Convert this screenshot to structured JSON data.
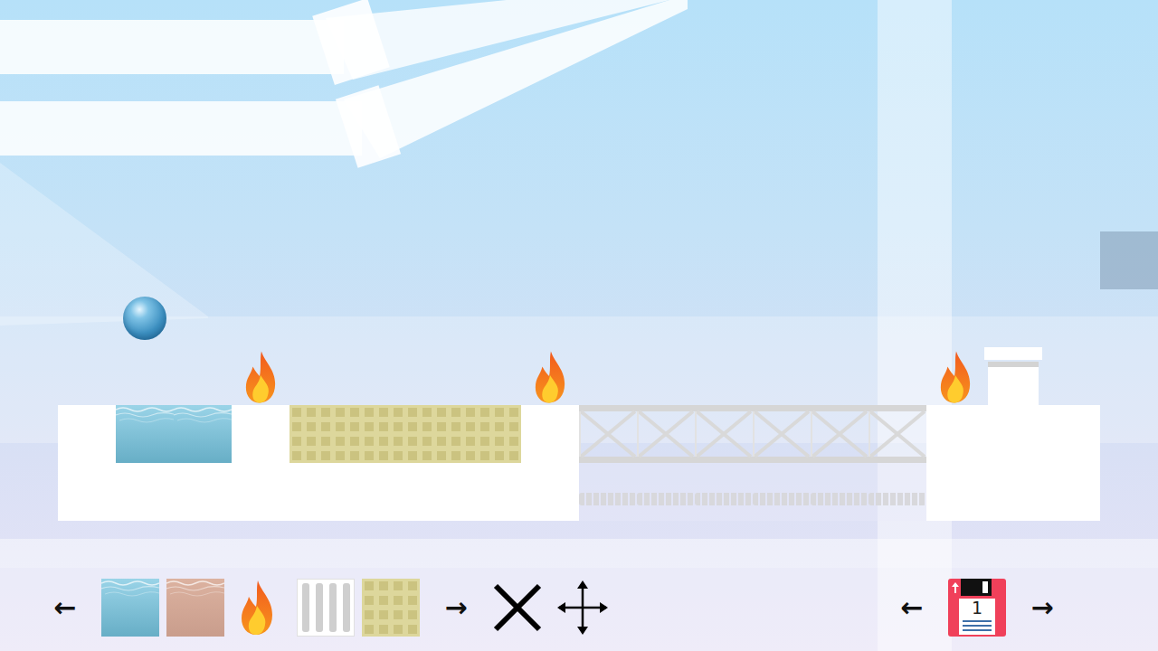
{
  "level": {
    "player": {
      "kind": "drop"
    },
    "grid": [
      [
        "empty",
        "empty",
        "empty",
        "fire",
        "empty",
        "empty",
        "empty",
        "empty",
        "fire",
        "empty",
        "empty",
        "empty",
        "empty",
        "empty",
        "empty",
        "fire",
        "goal",
        "empty"
      ],
      [
        "solid",
        "water",
        "water",
        "solid",
        "grate",
        "grate",
        "grate",
        "grate",
        "solid",
        "bridge",
        "bridge",
        "bridge",
        "bridge",
        "bridge",
        "bridge",
        "solid",
        "solid",
        "solid"
      ],
      [
        "solid",
        "solid",
        "solid",
        "solid",
        "solid",
        "solid",
        "solid",
        "solid",
        "solid",
        "rail",
        "rail",
        "rail",
        "rail",
        "rail",
        "rail",
        "solid",
        "solid",
        "solid"
      ]
    ]
  },
  "palette": {
    "prev": "←",
    "next": "→",
    "tools": [
      {
        "kind": "water"
      },
      {
        "kind": "mud"
      },
      {
        "kind": "fire"
      },
      {
        "kind": "bars"
      },
      {
        "kind": "grate"
      }
    ]
  },
  "actions": [
    {
      "kind": "delete"
    },
    {
      "kind": "move"
    }
  ],
  "save": {
    "prev": "←",
    "next": "→",
    "slot": "1"
  }
}
